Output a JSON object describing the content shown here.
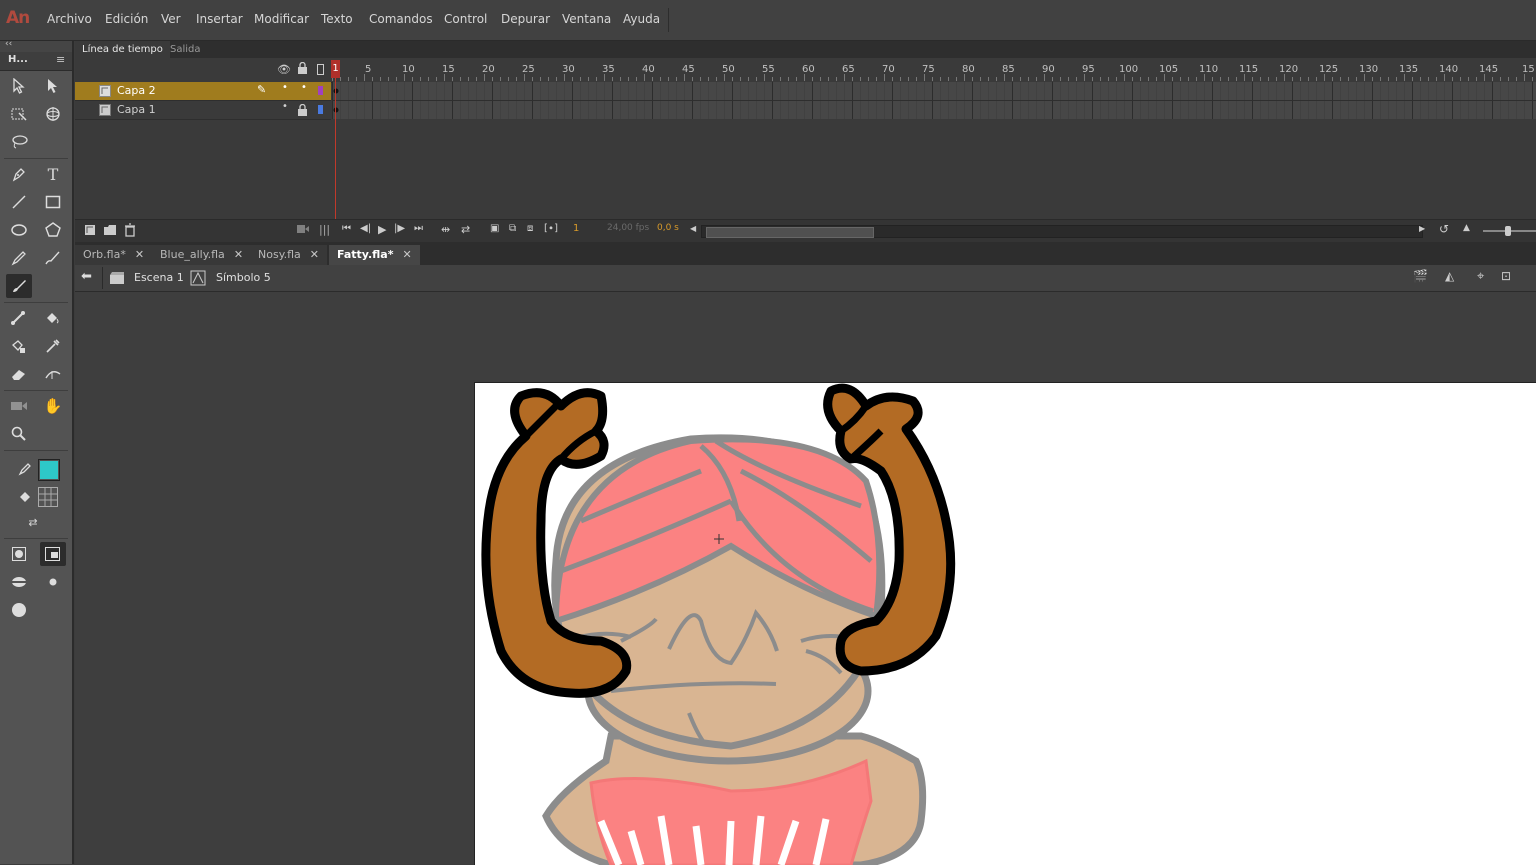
{
  "app": {
    "logo": "An"
  },
  "menu": [
    "Archivo",
    "Edición",
    "Ver",
    "Insertar",
    "Modificar",
    "Texto",
    "Comandos",
    "Control",
    "Depurar",
    "Ventana",
    "Ayuda"
  ],
  "toolbox": {
    "collapse": "‹‹",
    "header": "H..."
  },
  "timeline": {
    "tabs": [
      "Línea de tiempo",
      "Salida"
    ],
    "ruler": [
      "1",
      "5",
      "10",
      "15",
      "20",
      "25",
      "30",
      "35",
      "40",
      "45",
      "50",
      "55",
      "60",
      "65",
      "70",
      "75",
      "80",
      "85",
      "90",
      "95",
      "100",
      "105",
      "110",
      "115",
      "120",
      "125",
      "130",
      "135",
      "140",
      "145",
      "15"
    ],
    "layers": [
      {
        "name": "Capa 2",
        "selected": true,
        "color": "#a040c0"
      },
      {
        "name": "Capa 1",
        "selected": false,
        "color": "#4a7ae0"
      }
    ],
    "footer": {
      "frame": "1",
      "fps": "24,00 fps",
      "time": "0,0 s"
    }
  },
  "documents": [
    {
      "name": "Orb.fla*",
      "active": false
    },
    {
      "name": "Blue_ally.fla",
      "active": false
    },
    {
      "name": "Nosy.fla",
      "active": false
    },
    {
      "name": "Fatty.fla*",
      "active": true
    }
  ],
  "breadcrumb": {
    "scene": "Escena 1",
    "symbol": "Símbolo 5"
  },
  "colors": {
    "accent": "#a07c1e",
    "stroke_swatch": "#222222",
    "fill_swatch": "#2ec8c8"
  }
}
